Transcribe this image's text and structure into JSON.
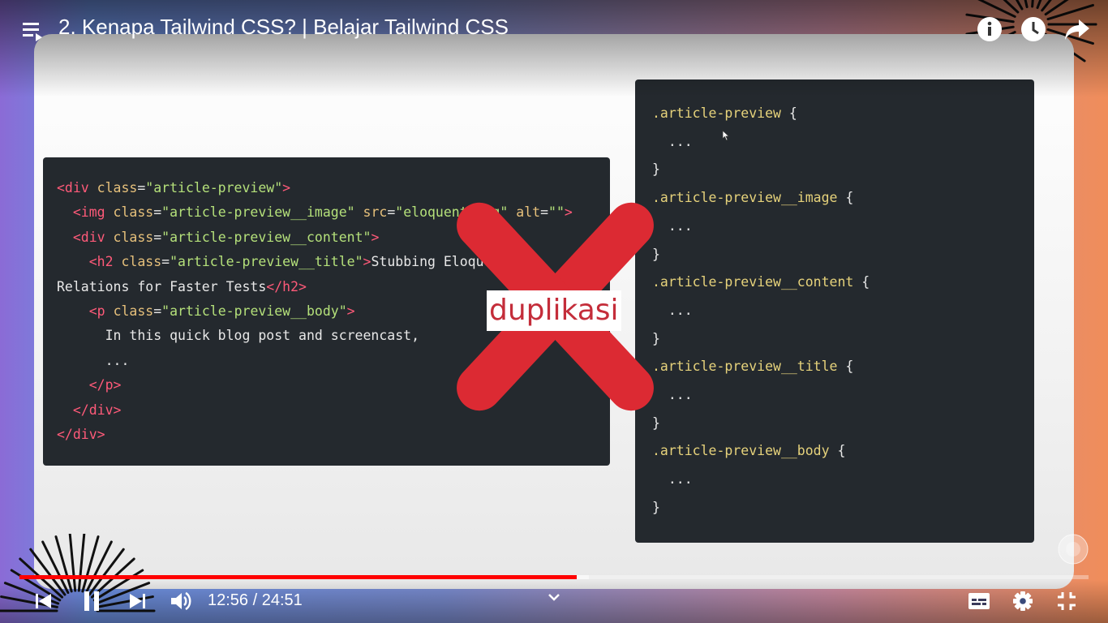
{
  "video": {
    "title": "2. Kenapa Tailwind CSS? | Belajar Tailwind CSS",
    "time_current": "12:56",
    "time_separator": " / ",
    "time_total": "24:51",
    "progress_fraction": 0.521,
    "buffered_fraction": 0.533
  },
  "slide": {
    "overlay_label": "duplikasi",
    "html_code": [
      {
        "indent": "",
        "parts": [
          [
            "tag",
            "<div "
          ],
          [
            "attr",
            "class"
          ],
          [
            "txt",
            "="
          ],
          [
            "str",
            "\"article-preview\""
          ],
          [
            "tag",
            ">"
          ]
        ]
      },
      {
        "indent": "  ",
        "parts": [
          [
            "tag",
            "<img "
          ],
          [
            "attr",
            "class"
          ],
          [
            "txt",
            "="
          ],
          [
            "str",
            "\"article-preview__image\" "
          ],
          [
            "attr",
            "src"
          ],
          [
            "txt",
            "="
          ],
          [
            "str",
            "\"eloquent.png\" "
          ],
          [
            "attr",
            "alt"
          ],
          [
            "txt",
            "="
          ],
          [
            "str",
            "\"\""
          ],
          [
            "tag",
            ">"
          ]
        ]
      },
      {
        "indent": "  ",
        "parts": [
          [
            "tag",
            "<div "
          ],
          [
            "attr",
            "class"
          ],
          [
            "txt",
            "="
          ],
          [
            "str",
            "\"article-preview__content\""
          ],
          [
            "tag",
            ">"
          ]
        ]
      },
      {
        "indent": "    ",
        "parts": [
          [
            "tag",
            "<h2 "
          ],
          [
            "attr",
            "class"
          ],
          [
            "txt",
            "="
          ],
          [
            "str",
            "\"article-preview__title\""
          ],
          [
            "tag",
            ">"
          ],
          [
            "txt",
            "Stubbing Eloquent"
          ]
        ]
      },
      {
        "indent": "",
        "parts": [
          [
            "txt",
            "Relations for Faster Tests"
          ],
          [
            "tag",
            "</h2>"
          ]
        ]
      },
      {
        "indent": "    ",
        "parts": [
          [
            "tag",
            "<p "
          ],
          [
            "attr",
            "class"
          ],
          [
            "txt",
            "="
          ],
          [
            "str",
            "\"article-preview__body\""
          ],
          [
            "tag",
            ">"
          ]
        ]
      },
      {
        "indent": "      ",
        "parts": [
          [
            "txt",
            "In this quick blog post and screencast,"
          ]
        ]
      },
      {
        "indent": "      ",
        "parts": [
          [
            "txt",
            "..."
          ]
        ]
      },
      {
        "indent": "    ",
        "parts": [
          [
            "tag",
            "</p>"
          ]
        ]
      },
      {
        "indent": "  ",
        "parts": [
          [
            "tag",
            "</div>"
          ]
        ]
      },
      {
        "indent": "",
        "parts": [
          [
            "tag",
            "</div>"
          ]
        ]
      }
    ],
    "css_code": [
      {
        "indent": "",
        "parts": [
          [
            "sel",
            ".article-preview "
          ],
          [
            "txt",
            "{"
          ]
        ]
      },
      {
        "indent": "  ",
        "parts": [
          [
            "txt",
            "..."
          ]
        ]
      },
      {
        "indent": "",
        "parts": [
          [
            "txt",
            "}"
          ]
        ]
      },
      {
        "indent": "",
        "parts": [
          [
            "sel",
            ".article-preview__image "
          ],
          [
            "txt",
            "{"
          ]
        ]
      },
      {
        "indent": "  ",
        "parts": [
          [
            "txt",
            "..."
          ]
        ]
      },
      {
        "indent": "",
        "parts": [
          [
            "txt",
            "}"
          ]
        ]
      },
      {
        "indent": "",
        "parts": [
          [
            "sel",
            ".article-preview__content "
          ],
          [
            "txt",
            "{"
          ]
        ]
      },
      {
        "indent": "  ",
        "parts": [
          [
            "txt",
            "..."
          ]
        ]
      },
      {
        "indent": "",
        "parts": [
          [
            "txt",
            "}"
          ]
        ]
      },
      {
        "indent": "",
        "parts": [
          [
            "sel",
            ".article-preview__title "
          ],
          [
            "txt",
            "{"
          ]
        ]
      },
      {
        "indent": "  ",
        "parts": [
          [
            "txt",
            "..."
          ]
        ]
      },
      {
        "indent": "",
        "parts": [
          [
            "txt",
            "}"
          ]
        ]
      },
      {
        "indent": "",
        "parts": [
          [
            "sel",
            ".article-preview__body "
          ],
          [
            "txt",
            "{"
          ]
        ]
      },
      {
        "indent": "  ",
        "parts": [
          [
            "txt",
            "..."
          ]
        ]
      },
      {
        "indent": "",
        "parts": [
          [
            "txt",
            "}"
          ]
        ]
      }
    ]
  },
  "icons": {
    "playlist": "playlist-icon",
    "info": "info-icon",
    "watch_later": "clock-icon",
    "share": "share-icon",
    "previous": "skip-previous-icon",
    "pause": "pause-icon",
    "next": "skip-next-icon",
    "volume": "volume-icon",
    "chapters": "chevron-down-icon",
    "subtitles": "subtitles-icon",
    "settings": "gear-icon",
    "exit_fullscreen": "exit-fullscreen-icon",
    "channel_watermark": "channel-watermark-icon"
  },
  "colors": {
    "progress": "#ff0000",
    "x_mark": "#dc2a33",
    "code_bg": "#24292e",
    "tag": "#ff5a79",
    "attr": "#e6c07b",
    "string": "#b4e07a"
  }
}
